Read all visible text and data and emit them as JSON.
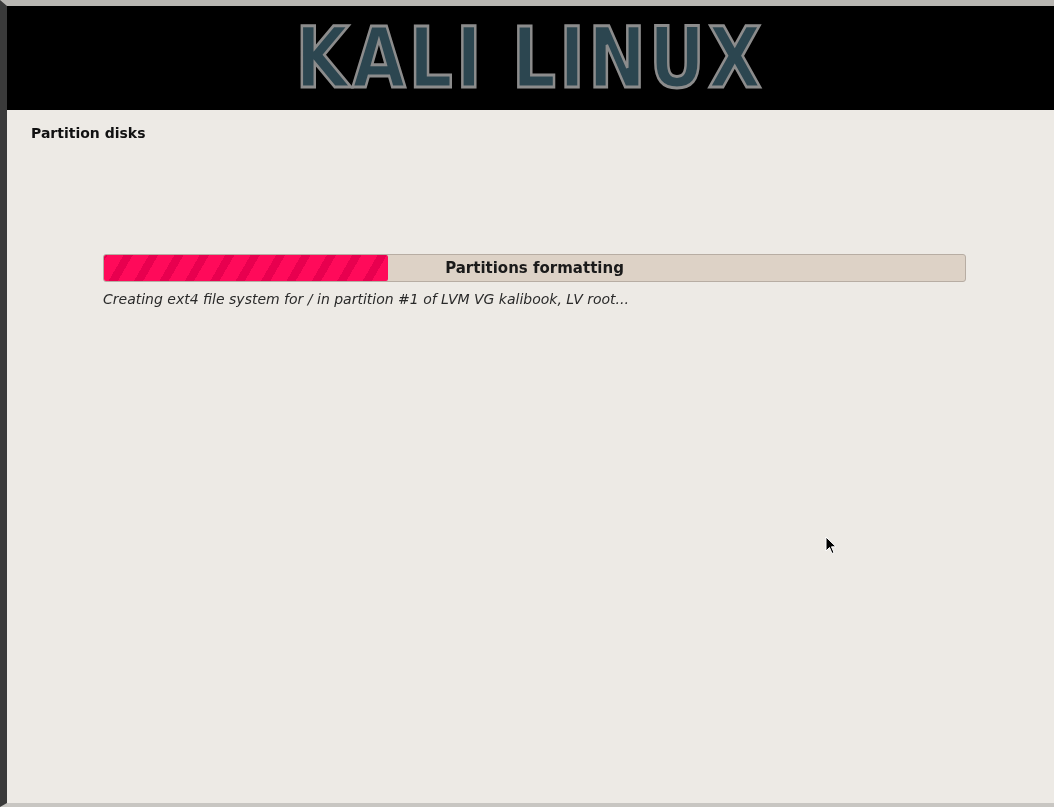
{
  "banner": {
    "logo": "KALI LINUX"
  },
  "step_title": "Partition disks",
  "progress": {
    "label": "Partitions formatting",
    "level": 0.33,
    "detail": "Creating ext4 file system for / in partition #1 of LVM VG kalibook, LV root..."
  }
}
